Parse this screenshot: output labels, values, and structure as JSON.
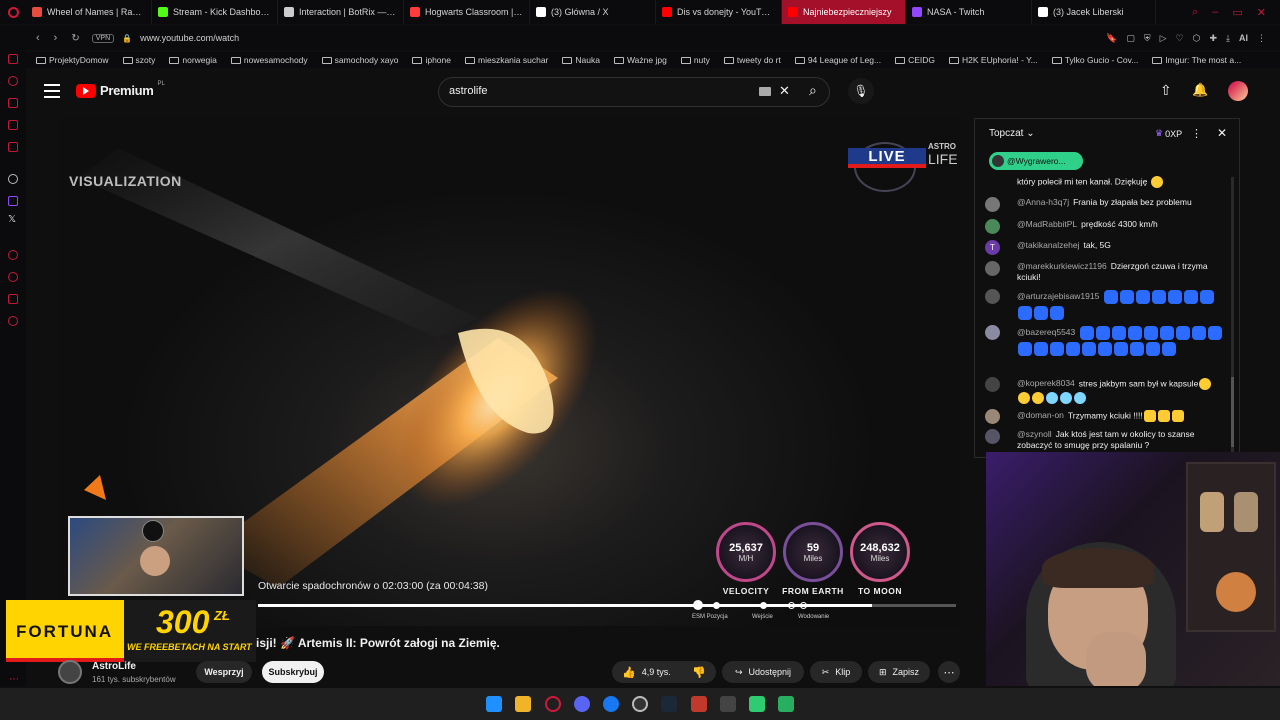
{
  "browser": {
    "tabs": [
      {
        "label": "Wheel of Names | Rando",
        "color": "#e74c3c"
      },
      {
        "label": "Stream - Kick Dashboard",
        "color": "#53fc18"
      },
      {
        "label": "Interaction | BotRix — Ch",
        "color": "#cccccc"
      },
      {
        "label": "Hogwarts Classroom | Ha",
        "color": "#ff3b3b"
      },
      {
        "label": "(3) Główna / X",
        "color": "#ffffff"
      },
      {
        "label": "Dis vs donejty - YouTube",
        "color": "#ff0000"
      },
      {
        "label": "Najniebezpieczniejszy",
        "color": "#ff0000",
        "active": true
      },
      {
        "label": "NASA - Twitch",
        "color": "#9146ff"
      },
      {
        "label": "(3) Jacek Liberski",
        "color": "#ffffff"
      }
    ],
    "url": "www.youtube.com/watch",
    "vpn": "VPN",
    "ai_label": "AI",
    "bookmarks": [
      "ProjektyDomow",
      "szoty",
      "norwegia",
      "nowesamochody",
      "samochody xayo",
      "iphone",
      "mieszkania suchar",
      "Nauka",
      "Ważne jpg",
      "nuty",
      "tweety do rt",
      "94 League of Leg...",
      "CEIDG",
      "H2K EUphoria! - Y...",
      "Tylko Gucio - Cov...",
      "Imgur: The most a..."
    ]
  },
  "youtube": {
    "logo": "Premium",
    "logo_country": "PL",
    "search_value": "astrolife"
  },
  "player": {
    "visualization_label": "VISUALIZATION",
    "live_badge": "LIVE",
    "astro_badge_1": "ASTRO",
    "astro_badge_2": "LIFE",
    "chute_text": "Otwarcie spadochronów o 02:03:00 (za 00:04:38)",
    "gauges": [
      {
        "value": "25,637",
        "unit": "M/H",
        "caption": "VELOCITY"
      },
      {
        "value": "59",
        "unit": "Miles",
        "caption": "FROM EARTH"
      },
      {
        "value": "248,632",
        "unit": "Miles",
        "caption": "TO MOON"
      }
    ],
    "progress_markers": [
      "ESM Pozycja",
      "Wejście",
      "Wodowanie"
    ],
    "progress": 0.88
  },
  "video": {
    "title": "isji! 🚀 Artemis II: Powrót załogi na Ziemię.",
    "channel": "AstroLife",
    "subs": "161 tys. subskrybentów",
    "support": "Wesprzyj",
    "subscribe": "Subskrybuj",
    "likes": "4,9 tys.",
    "share": "Udostępnij",
    "clip": "Klip",
    "save": "Zapisz"
  },
  "ad": {
    "brand": "FORTUNA",
    "amount": "300",
    "currency": "ZŁ",
    "tagline": "WE FREEBETACH NA START"
  },
  "chat": {
    "header": "Topczat",
    "xp": "0XP",
    "pinned_user": "@Wygrawero...",
    "cut_top": "który polecił mi ten kanał. Dziękuję",
    "messages": [
      {
        "user": "@Anna-h3q7j",
        "text": "Frania by złapała bez problemu"
      },
      {
        "user": "@MadRabbitPL",
        "text": "prędkość 4300 km/h"
      },
      {
        "user": "@takikanalzehej",
        "text": "tak, 5G",
        "initial": "T"
      },
      {
        "user": "@marekkurkiewicz1196",
        "text": "Dzierzgoń czuwa i trzyma kciuki!"
      },
      {
        "user": "@arturzajebisaw1915",
        "text": ""
      },
      {
        "user": "@bazereq5543",
        "text": ""
      },
      {
        "user": "@koperek8034",
        "text": "stres jakbym sam był w kapsule"
      },
      {
        "user": "@doman-on",
        "text": "Trzymamy kciuki !!!!"
      },
      {
        "user": "@szynoll",
        "text": "Jak ktoś jest tam w okolicy to szanse zobaczyć to smugę przy spalaniu ?"
      }
    ]
  },
  "colors": {
    "accent": "#c21a3a",
    "yt_red": "#ff0000",
    "fortuna_yellow": "#ffd400"
  }
}
